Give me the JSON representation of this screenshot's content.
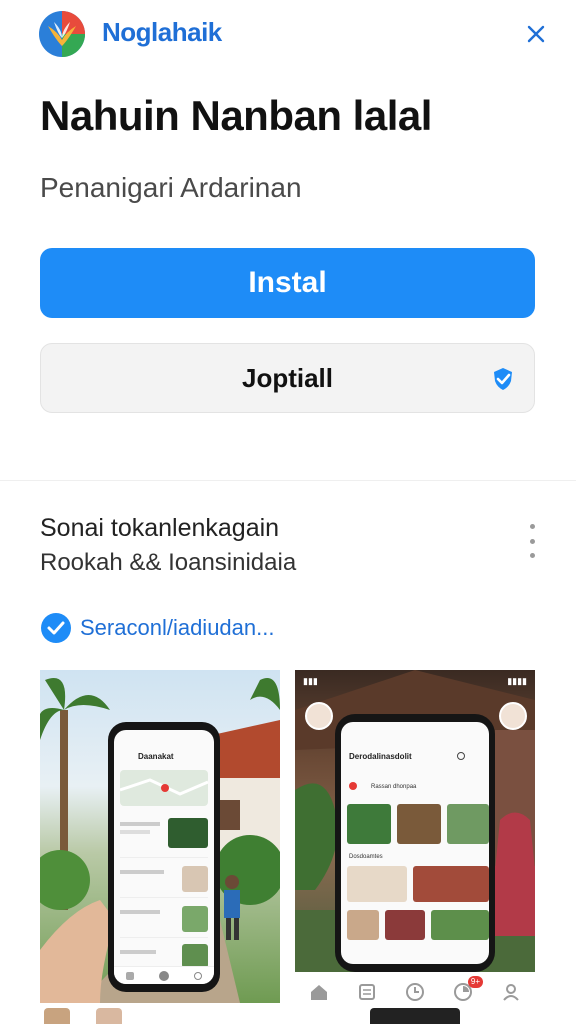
{
  "header": {
    "app_name": "Noglahaik",
    "logo_icon": "app-logo",
    "close_icon": "close-icon"
  },
  "app": {
    "title": "Nahuin Nanban lalal",
    "subtitle": "Penanigari Ardarinan"
  },
  "buttons": {
    "install_label": "Instal",
    "secondary_label": "Joptiall",
    "secondary_icon": "check-shield-icon"
  },
  "section": {
    "title": "Sonai tokanlenkagain",
    "subtitle": "Rookah && Ioansinidaia",
    "more_icon": "more-vertical-icon",
    "verified_text": "Seraconl/iadiudan..."
  },
  "screenshots": [
    {
      "phone_title": "Daanakat",
      "nav_icons": [
        "home-icon",
        "profile-icon",
        "chat-icon"
      ]
    },
    {
      "phone_title": "Derodalinasdolit",
      "caption_1": "Rassan dhonpaa",
      "caption_2": "Dosdoamtes"
    }
  ],
  "bottom_nav": {
    "items": [
      "home-icon",
      "list-icon",
      "clock-icon",
      "notifications-icon",
      "profile-icon"
    ],
    "badge": "9+"
  },
  "colors": {
    "accent": "#1e8cf7",
    "brand_text": "#1f6fd6",
    "button_secondary_bg": "#f3f3f3"
  }
}
